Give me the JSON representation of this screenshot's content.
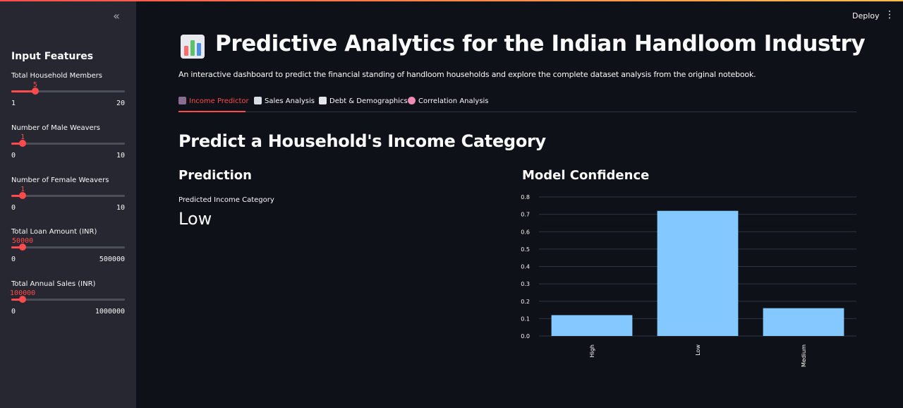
{
  "sidebar": {
    "collapse_icon": "«",
    "title": "Input Features",
    "sliders": [
      {
        "label": "Total Household Members",
        "value": 5,
        "min": 1,
        "max": 20
      },
      {
        "label": "Number of Male Weavers",
        "value": 1,
        "min": 0,
        "max": 10
      },
      {
        "label": "Number of Female Weavers",
        "value": 1,
        "min": 0,
        "max": 10
      },
      {
        "label": "Total Loan Amount (INR)",
        "value": 50000,
        "min": 0,
        "max": 500000
      },
      {
        "label": "Total Annual Sales (INR)",
        "value": 100000,
        "min": 0,
        "max": 1000000
      }
    ]
  },
  "header": {
    "deploy_label": "Deploy",
    "menu_icon": "⋮"
  },
  "page": {
    "title_icon": "bar-chart-icon",
    "title": "Predictive Analytics for the Indian Handloom Industry",
    "subtitle": "An interactive dashboard to predict the financial standing of handloom households and explore the complete dataset analysis from the original notebook."
  },
  "tabs": [
    {
      "label": "Income Predictor",
      "icon": "fortune-teller-icon",
      "active": true
    },
    {
      "label": "Sales Analysis",
      "icon": "line-chart-icon",
      "active": false
    },
    {
      "label": "Debt & Demographics",
      "icon": "document-icon",
      "active": false
    },
    {
      "label": "Correlation Analysis",
      "icon": "brain-icon",
      "active": false
    }
  ],
  "section": {
    "heading": "Predict a Household's Income Category",
    "prediction_heading": "Prediction",
    "metric_label": "Predicted Income Category",
    "metric_value": "Low",
    "confidence_heading": "Model Confidence"
  },
  "colors": {
    "accent": "#ff4b4b",
    "bar": "#83c9ff",
    "background": "#0e1117",
    "sidebar": "#262730"
  },
  "chart_data": {
    "type": "bar",
    "categories": [
      "High",
      "Low",
      "Medium"
    ],
    "values": [
      0.12,
      0.72,
      0.16
    ],
    "yticks": [
      "0.0",
      "0.1",
      "0.2",
      "0.3",
      "0.4",
      "0.5",
      "0.6",
      "0.7",
      "0.8"
    ],
    "ylim": [
      0,
      0.8
    ],
    "grid": true
  }
}
